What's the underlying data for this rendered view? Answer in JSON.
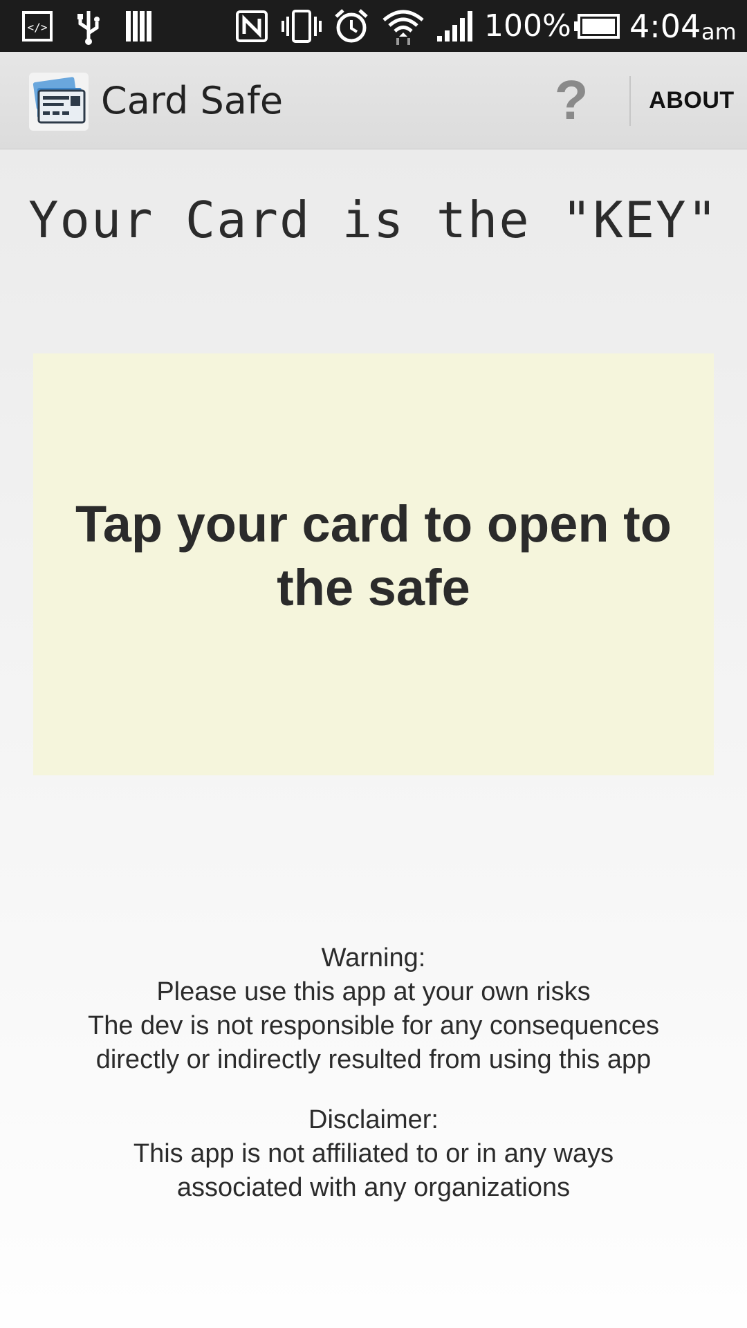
{
  "status_bar": {
    "battery_percent": "100%",
    "time": "4:04",
    "ampm": "am",
    "icons": [
      "dev-mode-icon",
      "usb-icon",
      "storage-icon",
      "nfc-icon",
      "vibrate-icon",
      "alarm-icon",
      "wifi-icon",
      "signal-icon",
      "battery-icon"
    ]
  },
  "action_bar": {
    "title": "Card Safe",
    "help_icon": "?",
    "about_label": "ABOUT"
  },
  "main": {
    "headline": "Your Card is the \"KEY\"",
    "tap_prompt": "Tap your card to open to the safe",
    "tap_area_color": "#f5f5dc",
    "warning": {
      "heading": "Warning:",
      "line1": "Please use this app at your own risks",
      "line2": "The dev is not responsible for any consequences",
      "line3": "directly or indirectly resulted from using this app"
    },
    "disclaimer": {
      "heading": "Disclaimer:",
      "line1": "This app is not affiliated to or in any ways",
      "line2": "associated with any organizations"
    }
  }
}
